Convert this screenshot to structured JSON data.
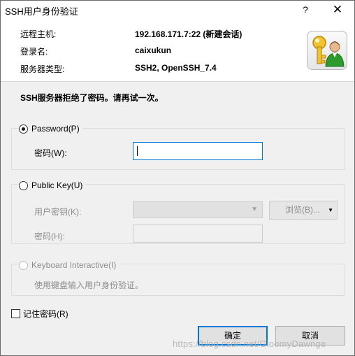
{
  "window": {
    "title": "SSH用户身份验证",
    "help_glyph": "?",
    "close_glyph": "✕"
  },
  "info": {
    "host_label": "远程主机:",
    "host_value": "192.168.171.7:22 (新建会话)",
    "login_label": "登录名:",
    "login_value": "caixukun",
    "server_label": "服务器类型:",
    "server_value": "SSH2, OpenSSH_7.4",
    "icon": "key-user-icon"
  },
  "message": "SSH服务器拒绝了密码。请再试一次。",
  "password_group": {
    "radio_label": "Password(P)",
    "selected": true,
    "field_label": "密码(W):",
    "value": ""
  },
  "publickey_group": {
    "radio_label": "Public Key(U)",
    "selected": false,
    "key_label": "用户密钥(K):",
    "key_value": "",
    "browse_label": "浏览(B)...",
    "pass_label": "密码(H):",
    "pass_value": ""
  },
  "keyboard_group": {
    "radio_label": "Keyboard Interactive(I)",
    "selected": false,
    "description": "使用键盘输入用户身份验证。"
  },
  "remember": {
    "label": "记住密码(R)",
    "checked": false
  },
  "buttons": {
    "ok": "确定",
    "cancel": "取消"
  },
  "watermark": "https://blog.csdn.net/GloomyDawnge",
  "colors": {
    "accent": "#0078d7",
    "dialog_bg": "#f0f0f0",
    "disabled_text": "#8d8d8d"
  }
}
